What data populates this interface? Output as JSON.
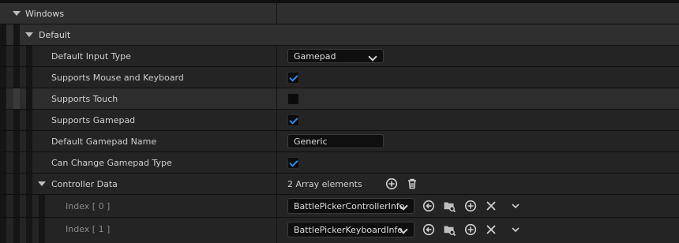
{
  "section": {
    "label": "Windows"
  },
  "category": {
    "label": "Default"
  },
  "properties": {
    "default_input_type": {
      "label": "Default Input Type",
      "value": "Gamepad"
    },
    "supports_mouse_keyboard": {
      "label": "Supports Mouse and Keyboard",
      "checked": true
    },
    "supports_touch": {
      "label": "Supports Touch",
      "checked": false
    },
    "supports_gamepad": {
      "label": "Supports Gamepad",
      "checked": true
    },
    "default_gamepad_name": {
      "label": "Default Gamepad Name",
      "value": "Generic"
    },
    "can_change_gamepad_type": {
      "label": "Can Change Gamepad Type",
      "checked": true
    }
  },
  "controller_data": {
    "label": "Controller Data",
    "summary": "2 Array elements",
    "items": [
      {
        "index_label": "Index [ 0 ]",
        "value": "BattlePickerControllerInfo"
      },
      {
        "index_label": "Index [ 1 ]",
        "value": "BattlePickerKeyboardInfo"
      }
    ]
  },
  "icons": [
    "add-element-icon",
    "delete-all-icon",
    "use-selected-icon",
    "browse-asset-icon",
    "insert-icon",
    "remove-icon",
    "expand-chevron-icon"
  ],
  "colors": {
    "check_accent": "#2a8ae8",
    "panel_bg": "#242424",
    "category_bg": "#2f2f2f"
  }
}
